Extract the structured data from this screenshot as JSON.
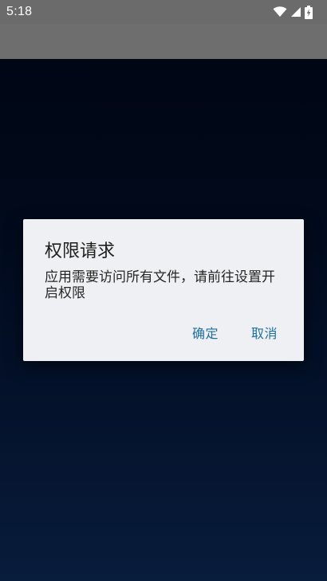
{
  "status_bar": {
    "time": "5:18",
    "icons": [
      "wifi-icon",
      "signal-icon",
      "battery-charging-icon"
    ]
  },
  "dialog": {
    "title": "权限请求",
    "message": "应用需要访问所有文件，请前往设置开启权限",
    "confirm_label": "确定",
    "cancel_label": "取消"
  },
  "colors": {
    "background_top": "#010617",
    "background_bottom": "#0b2650",
    "status_bar": "#6b6b6b",
    "dialog_bg": "#eef0f3",
    "button_text": "#1f6f9c"
  }
}
